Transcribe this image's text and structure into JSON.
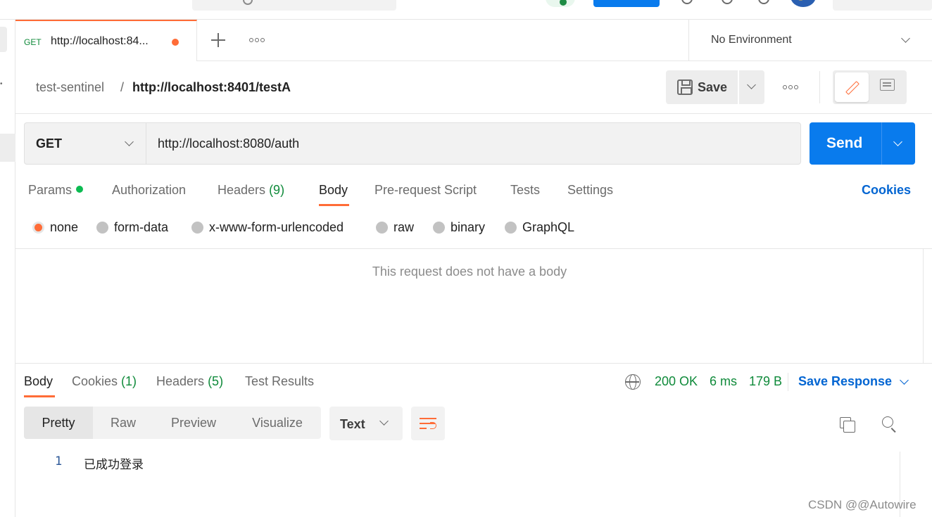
{
  "tab": {
    "method": "GET",
    "title": "http://localhost:84..."
  },
  "environment": {
    "label": "No Environment"
  },
  "breadcrumb": {
    "collection": "test-sentinel",
    "separator": "/",
    "request": "http://localhost:8401/testA"
  },
  "toolbar": {
    "save_label": "Save"
  },
  "request": {
    "method": "GET",
    "url": "http://localhost:8080/auth",
    "send_label": "Send"
  },
  "request_tabs": {
    "params": "Params",
    "authorization": "Authorization",
    "headers": "Headers",
    "headers_count": "(9)",
    "body": "Body",
    "prerequest": "Pre-request Script",
    "tests": "Tests",
    "settings": "Settings",
    "cookies": "Cookies"
  },
  "body_types": {
    "options": [
      "none",
      "form-data",
      "x-www-form-urlencoded",
      "raw",
      "binary",
      "GraphQL"
    ],
    "selected": "none"
  },
  "empty_body_message": "This request does not have a body",
  "response": {
    "tabs": {
      "body": "Body",
      "cookies": "Cookies",
      "cookies_count": "(1)",
      "headers": "Headers",
      "headers_count": "(5)",
      "test_results": "Test Results"
    },
    "status": "200 OK",
    "time": "6 ms",
    "size": "179 B",
    "save_response": "Save Response",
    "views": [
      "Pretty",
      "Raw",
      "Preview",
      "Visualize"
    ],
    "active_view": "Pretty",
    "format": "Text",
    "lines": [
      {
        "number": "1",
        "text": "已成功登录"
      }
    ]
  },
  "watermark": "CSDN @@Autowire",
  "colors": {
    "accent": "#ff6c37",
    "primary_blue": "#097bed",
    "success_green": "#0f8a3a",
    "link_blue": "#0265d2"
  },
  "icons": [
    "search-icon",
    "status-icon",
    "settings-icon",
    "notifications-icon",
    "avatar",
    "plus-icon",
    "more-icon",
    "chevron-down-icon",
    "save-icon",
    "edit-icon",
    "comment-icon",
    "globe-icon",
    "wrap-lines-icon",
    "copy-icon",
    "find-icon"
  ]
}
